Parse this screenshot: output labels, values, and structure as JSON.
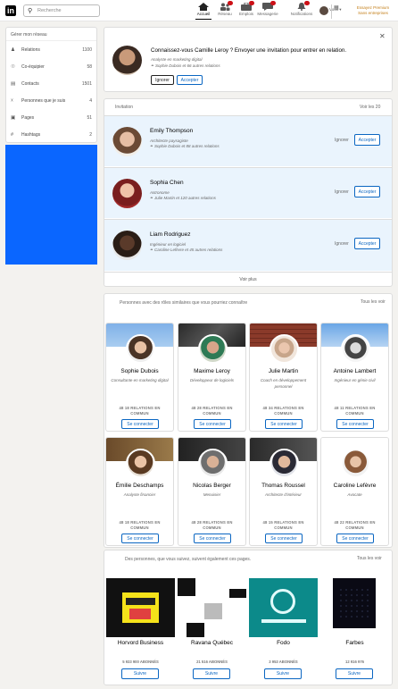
{
  "header": {
    "logo": "in",
    "search_placeholder": "Recherche",
    "nav": [
      {
        "label": "Accueil",
        "icon": "home-icon"
      },
      {
        "label": "Réseau",
        "icon": "network-icon"
      },
      {
        "label": "Emplois",
        "icon": "jobs-icon"
      },
      {
        "label": "Messagerie",
        "icon": "messaging-icon"
      },
      {
        "label": "Notifications",
        "icon": "bell-icon"
      }
    ],
    "me_label": "Vous ▾",
    "premium_line1": "Essayez Premium",
    "premium_line2": "Sans entreprises",
    "colors": {
      "brand": "#0a66c2",
      "premium": "#c37d16",
      "ad": "#0a66ff"
    }
  },
  "left": {
    "title": "Gérer mon réseau",
    "items": [
      {
        "label": "Relations",
        "count": "1100",
        "icon": "people-icon"
      },
      {
        "label": "Co-équipier",
        "count": "58",
        "icon": "contacts-icon"
      },
      {
        "label": "Contacts",
        "count": "1501",
        "icon": "book-icon"
      },
      {
        "label": "Personnes que je suis",
        "count": "4",
        "icon": "follow-icon"
      },
      {
        "label": "Pages",
        "count": "51",
        "icon": "pages-icon"
      },
      {
        "label": "Hashtags",
        "count": "2",
        "icon": "hashtag-icon"
      }
    ]
  },
  "suggestion": {
    "title": "Connaissez-vous Camille Leroy ? Envoyer une invitation pour entrer en relation.",
    "subtitle": "Analyste en marketing digital",
    "mutual": "Sophie Dubois et 66 autres relations",
    "ignore": "Ignorer",
    "accept": "Accepter"
  },
  "invitations": {
    "header": "Invitation",
    "see_all": "Voir les 20",
    "items": [
      {
        "name": "Emily Thompson",
        "headline": "Architecte paysagiste",
        "mutual": "Sophie Dubois et 88 autres relations"
      },
      {
        "name": "Sophia Chen",
        "headline": "Astronome",
        "mutual": "Julie Martin et 120 autres relations"
      },
      {
        "name": "Liam Rodriguez",
        "headline": "Ingénieur en logiciel",
        "mutual": "Caroline Lefèvre et 45 autres relations"
      }
    ],
    "ignore": "Ignorer",
    "accept": "Accepter",
    "see_more": "Voir plus"
  },
  "people": {
    "header": "Personnes avec des rôles similaires que vous pourriez connaître",
    "see_all": "Tous les voir",
    "connect": "Se connecter",
    "items": [
      {
        "name": "Sophie Dubois",
        "role": "Consultante en marketing digital",
        "common": "48 18 RELATIONS EN COMMUN"
      },
      {
        "name": "Maxime Leroy",
        "role": "Développeur de logiciels",
        "common": "48 28 RELATIONS EN COMMUN"
      },
      {
        "name": "Julie Martin",
        "role": "Coach en développement personnel",
        "common": "48 34 RELATIONS EN COMMUN"
      },
      {
        "name": "Antoine Lambert",
        "role": "Ingénieur en génie civil",
        "common": "48 11 RELATIONS EN COMMUN"
      },
      {
        "name": "Émilie Deschamps",
        "role": "Analyste financier",
        "common": "48 18 RELATIONS EN COMMUN"
      },
      {
        "name": "Nicolas Berger",
        "role": "Menuisier",
        "common": "48 28 RELATIONS EN COMMUN"
      },
      {
        "name": "Thomas Roussel",
        "role": "Architecte d'intérieur",
        "common": "48 15 RELATIONS EN COMMUN"
      },
      {
        "name": "Caroline Lefèvre",
        "role": "Avocate",
        "common": "48 22 RELATIONS EN COMMUN"
      }
    ]
  },
  "pages": {
    "header": "Des personnes, que vous suivez, suivent également ces pages.",
    "see_all": "Tous les voir",
    "follow": "Suivre",
    "items": [
      {
        "name": "Horvord Business",
        "followers": "5 933 900 ABONNÉS"
      },
      {
        "name": "Ravana Québec",
        "followers": "21 516 ABONNÉS"
      },
      {
        "name": "Fodo",
        "followers": "3 953 ABONNÉS"
      },
      {
        "name": "Farbes",
        "followers": "12 916 976"
      }
    ]
  }
}
